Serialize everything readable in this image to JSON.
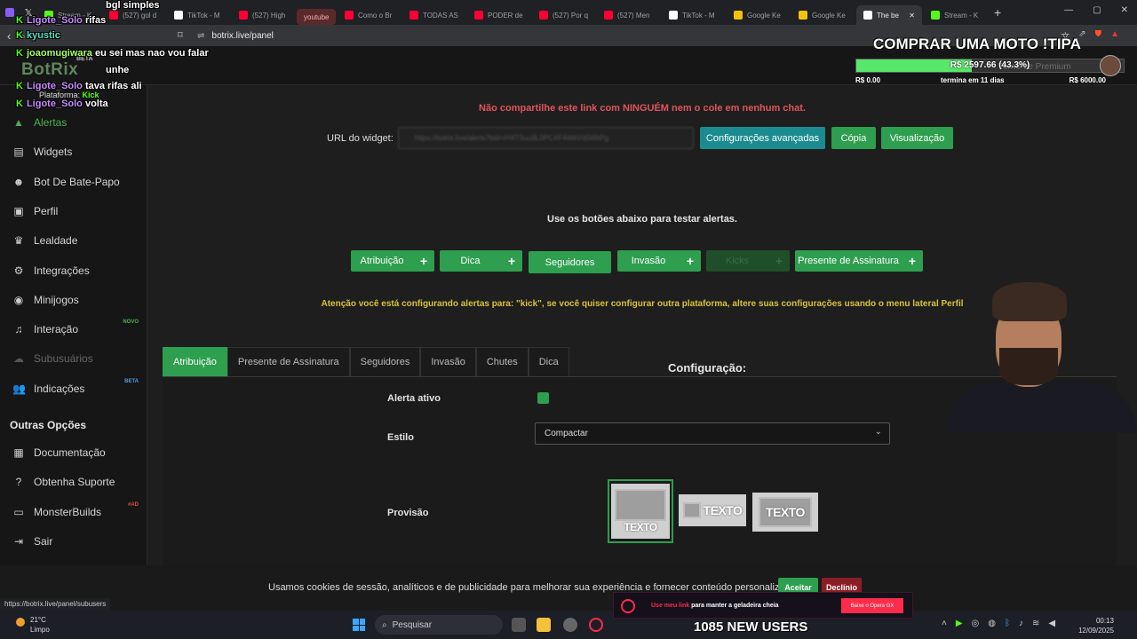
{
  "browser": {
    "tabs": [
      {
        "label": "Stream - K",
        "color": "#53fc18",
        "active": false
      },
      {
        "label": "(527) gol d",
        "color": "#ff0033",
        "active": false
      },
      {
        "label": "TikTok - M",
        "color": "#ffffff",
        "active": false
      },
      {
        "label": "(527) High",
        "color": "#ff0033",
        "active": false
      },
      {
        "label": "youtube",
        "color": "",
        "active": false,
        "chip": true
      },
      {
        "label": "Como o Br",
        "color": "#ff0033",
        "active": false
      },
      {
        "label": "TODAS AS",
        "color": "#ff0033",
        "active": false
      },
      {
        "label": "PODER de",
        "color": "#ff0033",
        "active": false
      },
      {
        "label": "(527) Por q",
        "color": "#ff0033",
        "active": false
      },
      {
        "label": "(527) Men",
        "color": "#ff0033",
        "active": false
      },
      {
        "label": "TikTok - M",
        "color": "#ffffff",
        "active": false
      },
      {
        "label": "Google Ke",
        "color": "#f4c20d",
        "active": false
      },
      {
        "label": "Google Ke",
        "color": "#f4c20d",
        "active": false
      },
      {
        "label": "The be",
        "color": "#ffffff",
        "active": true
      },
      {
        "label": "Stream - K",
        "color": "#53fc18",
        "active": false
      }
    ],
    "new_tab": "+",
    "url": "botrix.live/panel",
    "status_url": "https://botrix.live/panel/subusers"
  },
  "sidebar": {
    "items": [
      {
        "label": "Alertas",
        "icon": "warning-icon",
        "glyph": "▲",
        "state": "active"
      },
      {
        "label": "Widgets",
        "icon": "widgets-icon",
        "glyph": "▤",
        "state": ""
      },
      {
        "label": "Bot De Bate-Papo",
        "icon": "robot-icon",
        "glyph": "☻",
        "state": ""
      },
      {
        "label": "Perfil",
        "icon": "profile-icon",
        "glyph": "▣",
        "state": ""
      },
      {
        "label": "Lealdade",
        "icon": "trophy-icon",
        "glyph": "♛",
        "state": ""
      },
      {
        "label": "Integrações",
        "icon": "integrations-icon",
        "glyph": "⚙",
        "state": ""
      },
      {
        "label": "Minijogos",
        "icon": "gamepad-icon",
        "glyph": "◉",
        "state": ""
      },
      {
        "label": "Interação",
        "icon": "music-icon",
        "glyph": "♫",
        "state": "",
        "badge": "NOVO"
      },
      {
        "label": "Subusuários",
        "icon": "users-icon",
        "glyph": "☁",
        "state": "disabled"
      },
      {
        "label": "Indicações",
        "icon": "referrals-icon",
        "glyph": "👥",
        "state": "",
        "badge": "BETA"
      }
    ],
    "other_title": "Outras Opções",
    "other_items": [
      {
        "label": "Documentação",
        "icon": "docs-icon",
        "glyph": "▦"
      },
      {
        "label": "Obtenha Suporte",
        "icon": "help-icon",
        "glyph": "?"
      },
      {
        "label": "MonsterBuilds",
        "icon": "monitor-icon",
        "glyph": "▭",
        "badge": "#AD"
      },
      {
        "label": "Sair",
        "icon": "logout-icon",
        "glyph": "⇥"
      }
    ]
  },
  "main": {
    "warning": "Não compartilhe este link com NINGUÉM nem o cole em nenhum chat.",
    "url_label": "URL do widget:",
    "url_value": "https://botrix.live/alerts?bid=rH4TSuu9L0PCXF4WbVd5WkPg",
    "buttons": {
      "advanced": "Configurações avançadas",
      "copy": "Cópia",
      "preview": "Visualização"
    },
    "test_hint": "Use os botões abaixo para testar alertas.",
    "test_buttons": [
      {
        "label": "Atribuição",
        "plus": true,
        "dim": false
      },
      {
        "label": "Dica",
        "plus": true,
        "dim": false
      },
      {
        "label": "Seguidores",
        "plus": false,
        "dim": false
      },
      {
        "label": "Invasão",
        "plus": true,
        "dim": false
      },
      {
        "label": "Kicks",
        "plus": true,
        "dim": true
      },
      {
        "label": "Presente de Assinatura",
        "plus": true,
        "dim": false
      }
    ],
    "plus_glyph": "+",
    "attention": "Atenção você está configurando alertas para: \"kick\", se você quiser configurar outra plataforma, altere suas configurações usando o menu lateral Perfil",
    "tabs": [
      "Atribuição",
      "Presente de Assinatura",
      "Seguidores",
      "Invasão",
      "Chutes",
      "Dica"
    ],
    "config_title": "Configuração:",
    "alert_active_label": "Alerta ativo",
    "style_label": "Estilo",
    "style_value": "Compactar",
    "provision_label": "Provisão",
    "provision_text": "TEXTO"
  },
  "cookie": {
    "message": "Usamos cookies de sessão, analíticos e de publicidade para melhorar sua experiência e fornecer conteúdo personalizado.",
    "accept": "Aceitar",
    "decline": "Declínio"
  },
  "overlay": {
    "chat": [
      {
        "user": "",
        "message": "bgl simples"
      },
      {
        "user": "Ligote_Solo",
        "message": "rifas",
        "color": "purple"
      },
      {
        "user": "kyustic",
        "message": "",
        "color": "teal"
      },
      {
        "user": "joaomugiwara",
        "message": "eu sei mas nao vou falar",
        "color": "green"
      },
      {
        "user": "",
        "message": "unhe"
      },
      {
        "user": "Ligote_Solo",
        "message": "tava rifas ali",
        "color": "purple"
      },
      {
        "user": "Ligote_Solo",
        "message": "volta",
        "color": "purple"
      }
    ],
    "botrix_logo": "BotRix",
    "beta_tag": "BETA",
    "platform_prefix": "Plataforma:",
    "platform_value": "Kick",
    "goal_title": "COMPRAR UMA MOTO !TIPA",
    "goal_current": "R$ 2597.66 (43.3%)",
    "goal_fraction": 0.433,
    "goal_min": "R$ 0.00",
    "goal_ends": "termina em 11 dias",
    "goal_max": "R$ 6000.00",
    "premium": "Torne-se Premium",
    "ad_text": "Use meu link",
    "ad_text_rest": " para manter a geladeira cheia",
    "ad_button": "Baixe o Opera GX",
    "new_users": "1085 NEW USERS"
  },
  "taskbar": {
    "temp": "21°C",
    "weather": "Limpo",
    "search": "Pesquisar",
    "time": "00:13",
    "date": "12/09/2025"
  }
}
